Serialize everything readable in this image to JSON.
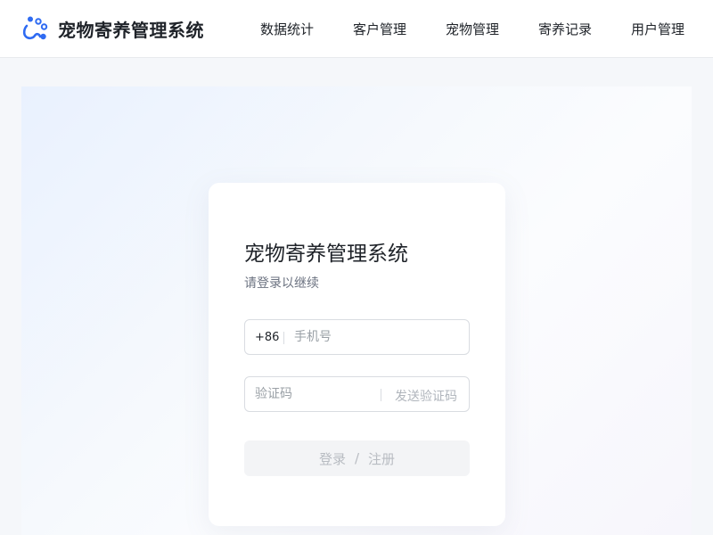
{
  "brand": {
    "title": "宠物寄养管理系统",
    "logo_icon": "paw-icon",
    "accent_color": "#2f6bf2"
  },
  "nav": {
    "items": [
      {
        "label": "数据统计"
      },
      {
        "label": "客户管理"
      },
      {
        "label": "宠物管理"
      },
      {
        "label": "寄养记录"
      },
      {
        "label": "用户管理"
      }
    ]
  },
  "login": {
    "title": "宠物寄养管理系统",
    "subtitle": "请登录以继续",
    "phone_prefix": "+86",
    "phone_placeholder": "手机号",
    "code_placeholder": "验证码",
    "send_code_label": "发送验证码",
    "login_label": "登录",
    "separator": "/",
    "register_label": "注册"
  }
}
